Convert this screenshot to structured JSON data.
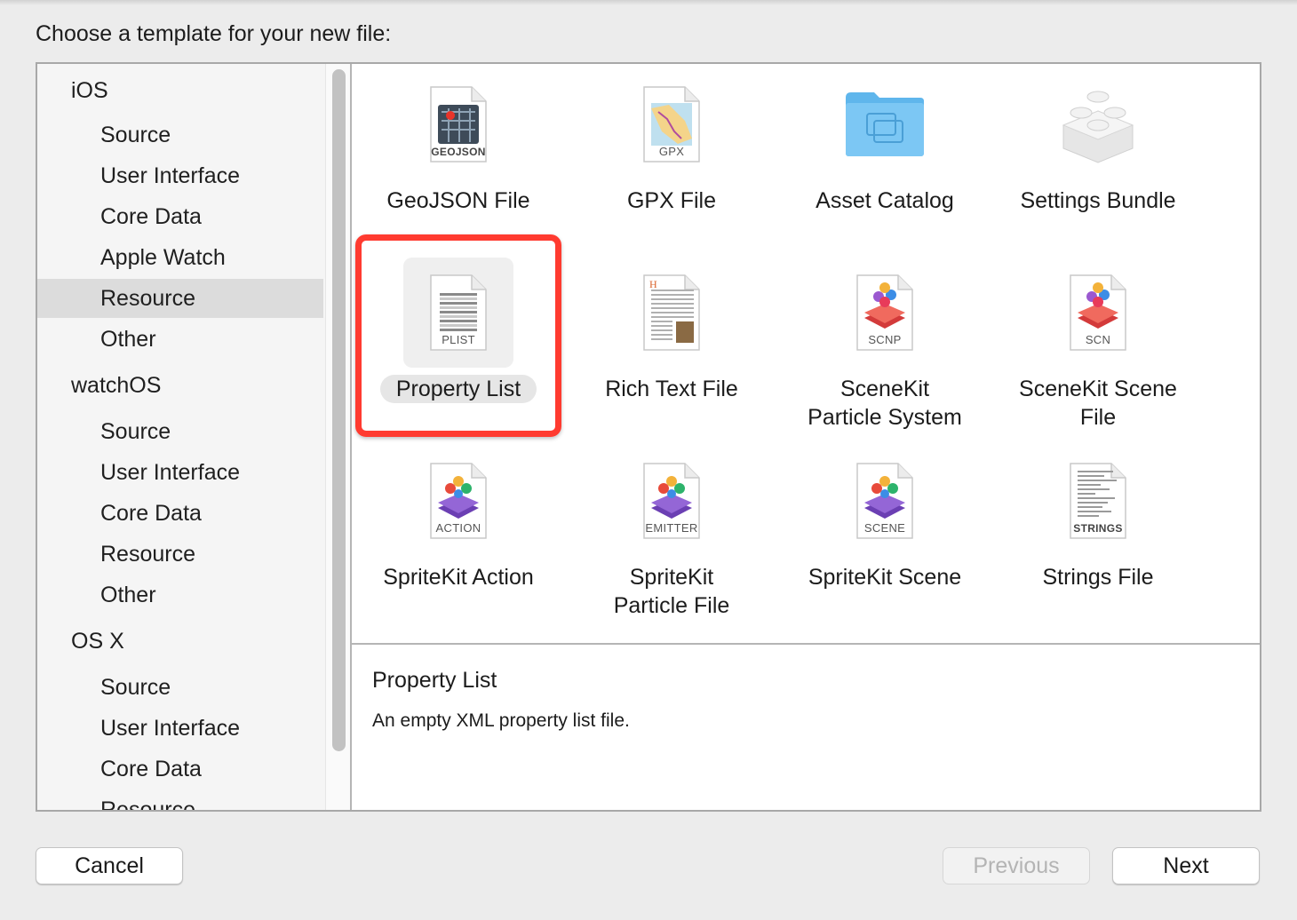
{
  "heading": "Choose a template for your new file:",
  "sidebar": {
    "items": [
      {
        "label": "iOS",
        "kind": "group"
      },
      {
        "label": "Source",
        "kind": "sub"
      },
      {
        "label": "User Interface",
        "kind": "sub"
      },
      {
        "label": "Core Data",
        "kind": "sub"
      },
      {
        "label": "Apple Watch",
        "kind": "sub"
      },
      {
        "label": "Resource",
        "kind": "sub",
        "selected": true
      },
      {
        "label": "Other",
        "kind": "sub"
      },
      {
        "label": "watchOS",
        "kind": "group"
      },
      {
        "label": "Source",
        "kind": "sub"
      },
      {
        "label": "User Interface",
        "kind": "sub"
      },
      {
        "label": "Core Data",
        "kind": "sub"
      },
      {
        "label": "Resource",
        "kind": "sub"
      },
      {
        "label": "Other",
        "kind": "sub"
      },
      {
        "label": "OS X",
        "kind": "group"
      },
      {
        "label": "Source",
        "kind": "sub"
      },
      {
        "label": "User Interface",
        "kind": "sub"
      },
      {
        "label": "Core Data",
        "kind": "sub"
      },
      {
        "label": "Resource",
        "kind": "sub"
      }
    ]
  },
  "templates": [
    {
      "label": "GeoJSON File",
      "icon": "geojson-file-icon",
      "caption": "GEOJSON"
    },
    {
      "label": "GPX File",
      "icon": "gpx-file-icon",
      "caption": "GPX"
    },
    {
      "label": "Asset Catalog",
      "icon": "folder-icon",
      "caption": ""
    },
    {
      "label": "Settings Bundle",
      "icon": "lego-brick-icon",
      "caption": ""
    },
    {
      "label": "Property List",
      "icon": "plist-file-icon",
      "caption": "PLIST",
      "selected": true
    },
    {
      "label": "Rich Text File",
      "icon": "rich-text-file-icon",
      "caption": ""
    },
    {
      "label": "SceneKit\nParticle System",
      "icon": "scnp-file-icon",
      "caption": "SCNP"
    },
    {
      "label": "SceneKit Scene\nFile",
      "icon": "scn-file-icon",
      "caption": "SCN"
    },
    {
      "label": "SpriteKit Action",
      "icon": "action-file-icon",
      "caption": "ACTION"
    },
    {
      "label": "SpriteKit\nParticle File",
      "icon": "emitter-file-icon",
      "caption": "EMITTER"
    },
    {
      "label": "SpriteKit Scene",
      "icon": "scene-file-icon",
      "caption": "SCENE"
    },
    {
      "label": "Strings File",
      "icon": "strings-file-icon",
      "caption": "STRINGS"
    }
  ],
  "description": {
    "title": "Property List",
    "text": "An empty XML property list file."
  },
  "buttons": {
    "cancel": "Cancel",
    "previous": "Previous",
    "next": "Next"
  },
  "colors": {
    "highlight_box": "#ff3b30",
    "selection_bg": "#dcdcdc"
  }
}
